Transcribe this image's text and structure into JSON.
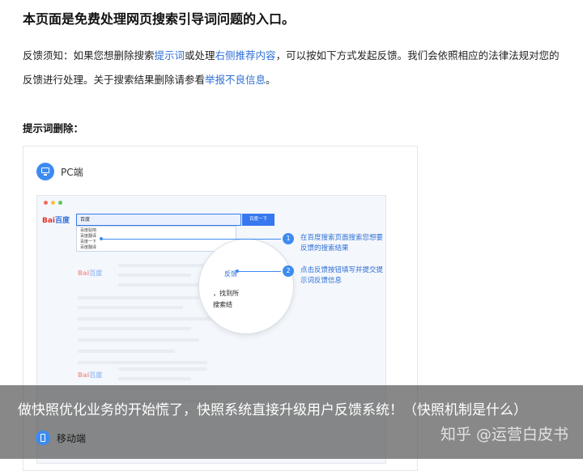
{
  "page": {
    "title": "本页面是免费处理网页搜索引导词问题的入口。",
    "intro_1": "反馈须知：如果您想删除搜索",
    "intro_link_1": "提示词",
    "intro_2": "或处理",
    "intro_link_2": "右侧推荐内容",
    "intro_3": "，可以按如下方式发起反馈。我们会依照相应的法律法规对您的反馈进行处理。关于搜索结果删除请参看",
    "intro_link_3": "举报不良信息",
    "intro_4": "。",
    "section_heading": "提示词删除："
  },
  "pc_section": {
    "icon": "monitor-icon",
    "label": "PC端",
    "browser": {
      "logo_red": "Bai",
      "logo_blue": "百度",
      "search_value": "百度",
      "search_button": "百度一下",
      "suggestions": [
        "百度贴吧",
        "百度翻译",
        "百度一下",
        "百度翻译"
      ],
      "magnifier_feedback": "反馈",
      "magnifier_line_1": "，找到所",
      "magnifier_line_2": "搜索结"
    },
    "callouts": [
      {
        "number": "1",
        "text": "在百度搜索页面搜索您想要反馈的搜索结果"
      },
      {
        "number": "2",
        "text": "点击反馈按钮填写并提交提示词反馈信息"
      }
    ]
  },
  "mobile_section": {
    "icon": "phone-icon",
    "label": "移动端"
  },
  "overlay": {
    "caption": "做快照优化业务的开始慌了，快照系统直接升级用户反馈系统！（快照机制是什么）",
    "watermark": "知乎 @运营白皮书"
  },
  "colors": {
    "accent": "#3d8bf0",
    "link": "#2e6fd6",
    "logo_red": "#e4332d"
  }
}
